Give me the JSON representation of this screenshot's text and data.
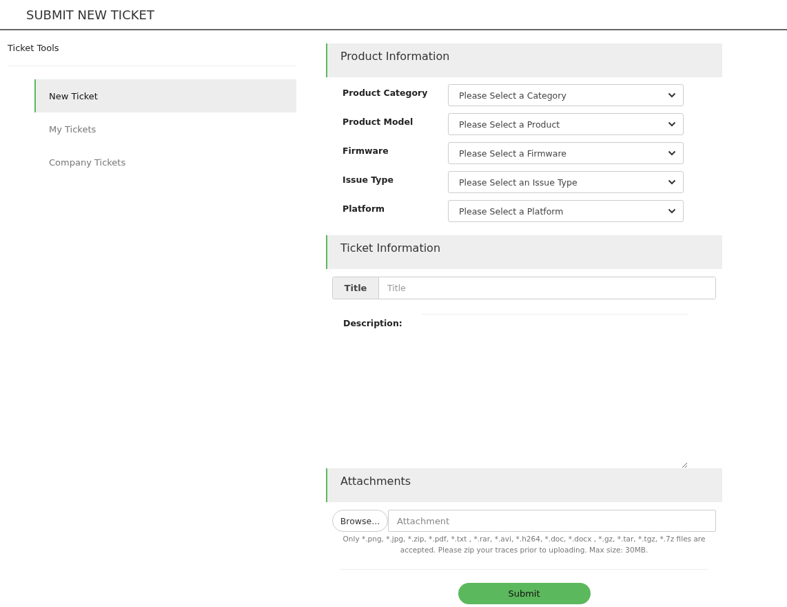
{
  "header": {
    "title": "SUBMIT NEW TICKET"
  },
  "sidebar": {
    "title": "Ticket Tools",
    "items": [
      {
        "label": "New Ticket",
        "selected": true
      },
      {
        "label": "My Tickets",
        "selected": false
      },
      {
        "label": "Company Tickets",
        "selected": false
      }
    ]
  },
  "product_information": {
    "heading": "Product Information",
    "fields": [
      {
        "label": "Product Category",
        "placeholder": "Please Select a Category"
      },
      {
        "label": "Product Model",
        "placeholder": "Please Select a Product"
      },
      {
        "label": "Firmware",
        "placeholder": "Please Select a Firmware"
      },
      {
        "label": "Issue Type",
        "placeholder": "Please Select an Issue Type"
      },
      {
        "label": "Platform",
        "placeholder": "Please Select a Platform"
      }
    ]
  },
  "ticket_information": {
    "heading": "Ticket Information",
    "title_field": {
      "label": "Title",
      "placeholder": "Title"
    },
    "description": {
      "label": "Description:"
    }
  },
  "attachments": {
    "heading": "Attachments",
    "browse_button": "Browse...",
    "field": {
      "placeholder": "Attachment"
    },
    "note": "Only *.png, *.jpg, *.zip, *.pdf, *.txt , *.rar, *.avi, *.h264, *.doc, *.docx , *.gz, *.tar, *.tgz, *.7z files are accepted. Please zip your traces prior to uploading. Max size: 30MB."
  },
  "submit_button": "Submit"
}
